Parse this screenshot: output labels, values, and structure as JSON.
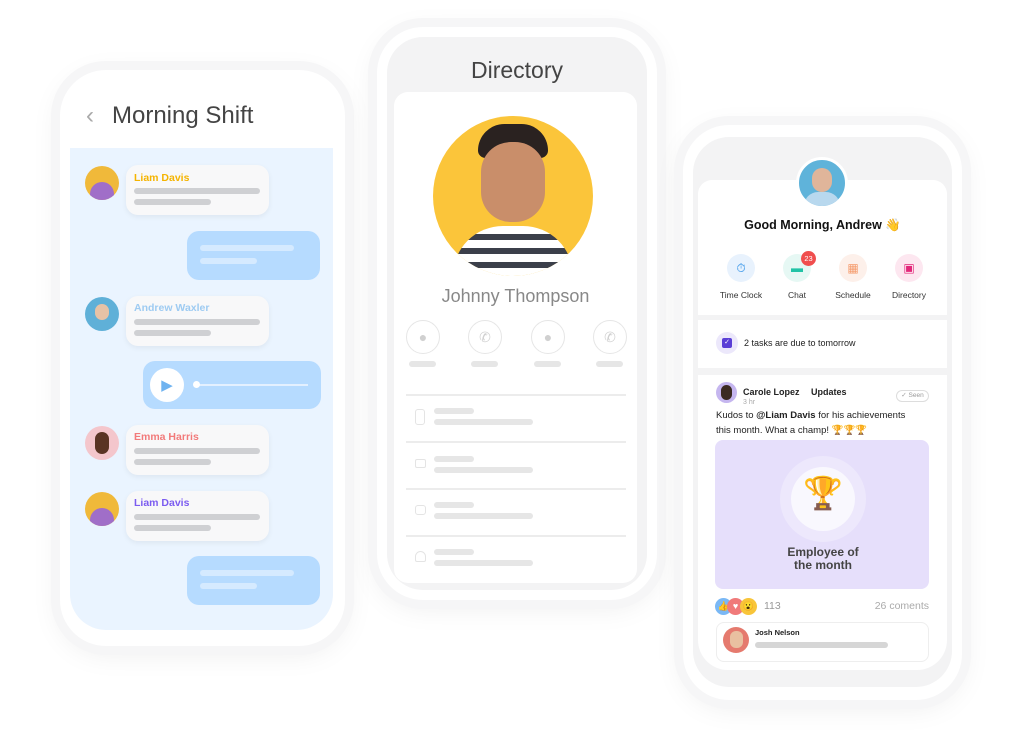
{
  "chat": {
    "title": "Morning Shift",
    "back_icon": "chevron-left-icon",
    "messages": [
      {
        "sender": "Liam Davis",
        "color": "#f5b400"
      },
      {
        "sender": "Andrew Waxler",
        "color": "#9ecbf2"
      },
      {
        "sender": "Emma Harris",
        "color": "#f27a7a"
      },
      {
        "sender": "Liam Davis",
        "color": "#7b5cf0"
      }
    ]
  },
  "directory": {
    "title": "Directory",
    "contact_name": "Johnny Thompson",
    "avatar_bg": "#fbc53a"
  },
  "home": {
    "greeting": "Good Morning, Andrew 👋",
    "quick_actions": [
      {
        "label": "Time Clock",
        "icon": "stopwatch-icon",
        "color": "#1e88e5"
      },
      {
        "label": "Chat",
        "icon": "chat-icon",
        "color": "#22c3a6",
        "badge": "23"
      },
      {
        "label": "Schedule",
        "icon": "calendar-icon",
        "color": "#f59a6b"
      },
      {
        "label": "Directory",
        "icon": "contact-card-icon",
        "color": "#e2277a"
      }
    ],
    "task_text": "2 tasks are due to tomorrow",
    "post": {
      "author": "Carole Lopez",
      "channel": "Updates",
      "time": "3 hr",
      "seen_label": "Seen",
      "text_prefix": "Kudos to ",
      "mention": "@Liam Davis",
      "text_suffix": " for his achievements this month. What a champ! 🏆🏆🏆",
      "card_title": "Employee of the month",
      "reaction_count": "113",
      "comments": "26 coments",
      "commenter": "Josh Nelson"
    }
  }
}
